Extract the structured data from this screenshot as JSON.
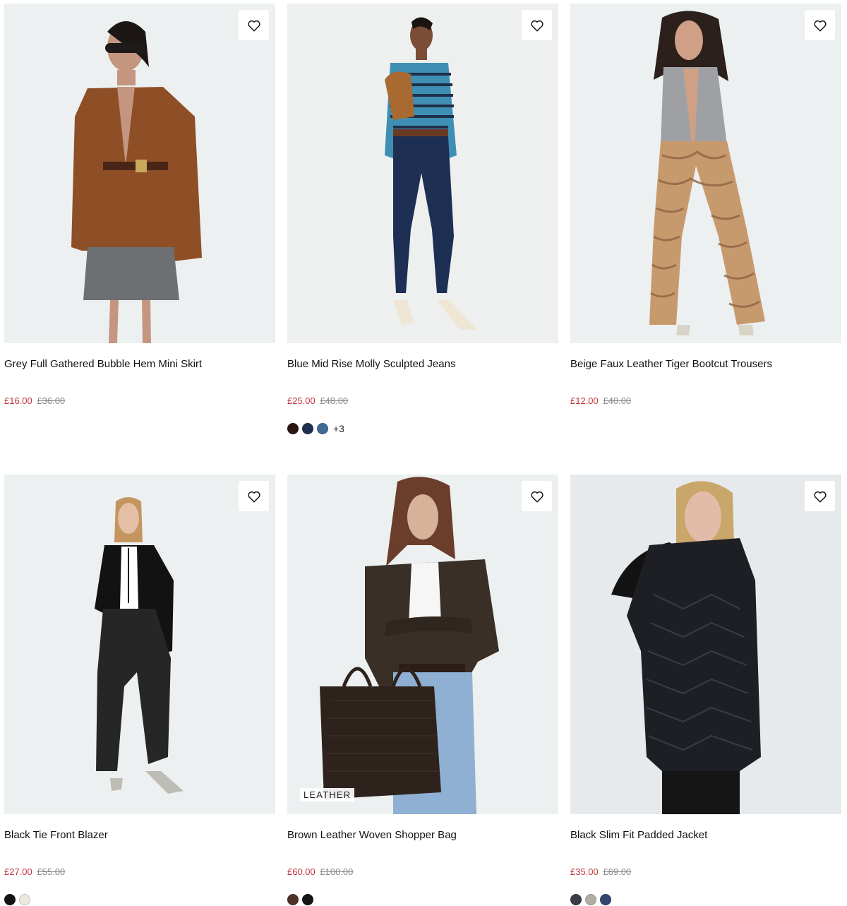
{
  "products": [
    {
      "name": "Grey Full Gathered Bubble Hem Mini Skirt",
      "price_now": "£16.00",
      "price_was": "£36.00",
      "swatches": [],
      "more": ""
    },
    {
      "name": "Blue Mid Rise Molly Sculpted Jeans",
      "price_now": "£25.00",
      "price_was": "£48.00",
      "swatches": [
        "#2a1612",
        "#1f3150",
        "#3e6a95"
      ],
      "more": "+3"
    },
    {
      "name": "Beige Faux Leather Tiger Bootcut Trousers",
      "price_now": "£12.00",
      "price_was": "£40.00",
      "swatches": [],
      "more": ""
    },
    {
      "name": "Black Tie Front Blazer",
      "price_now": "£27.00",
      "price_was": "£55.00",
      "swatches": [
        "#141414",
        "#ebe8dc"
      ],
      "more": ""
    },
    {
      "name": "Brown Leather Woven Shopper Bag",
      "price_now": "£60.00",
      "price_was": "£100.00",
      "badge": "LEATHER",
      "swatches": [
        "#4d3328",
        "#151515"
      ],
      "more": ""
    },
    {
      "name": "Black Slim Fit Padded Jacket",
      "price_now": "£35.00",
      "price_was": "£69.00",
      "swatches": [
        "#3a3d44",
        "#b1aca4",
        "#34456e"
      ],
      "more": ""
    }
  ],
  "icons": {
    "wishlist": "heart-outline-icon"
  },
  "colors": {
    "sale_price": "#c2353b",
    "was_price": "#8a8a8a",
    "image_bg": "#eceff0"
  }
}
